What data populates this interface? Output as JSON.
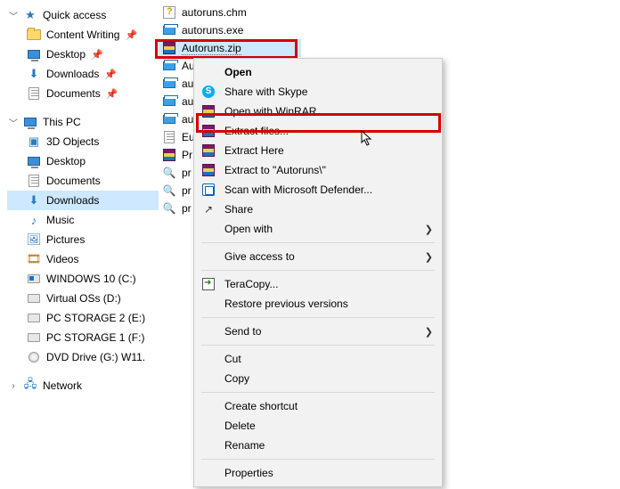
{
  "tree": {
    "quick_access": "Quick access",
    "qa_items": [
      {
        "label": "Content Writing"
      },
      {
        "label": "Desktop"
      },
      {
        "label": "Downloads"
      },
      {
        "label": "Documents"
      }
    ],
    "this_pc": "This PC",
    "pc_items": [
      {
        "label": "3D Objects"
      },
      {
        "label": "Desktop"
      },
      {
        "label": "Documents"
      },
      {
        "label": "Downloads",
        "selected": true
      },
      {
        "label": "Music"
      },
      {
        "label": "Pictures"
      },
      {
        "label": "Videos"
      },
      {
        "label": "WINDOWS 10 (C:)"
      },
      {
        "label": "Virtual OSs (D:)"
      },
      {
        "label": "PC STORAGE 2 (E:)"
      },
      {
        "label": "PC STORAGE 1 (F:)"
      },
      {
        "label": "DVD Drive (G:) W11."
      }
    ],
    "network": "Network"
  },
  "files": [
    {
      "icon": "chm",
      "label": "autoruns.chm"
    },
    {
      "icon": "exe",
      "label": "autoruns.exe"
    },
    {
      "icon": "rar",
      "label": "Autoruns.zip",
      "selected": true
    },
    {
      "icon": "exe",
      "label": "Au"
    },
    {
      "icon": "exe",
      "label": "au"
    },
    {
      "icon": "exe",
      "label": "au"
    },
    {
      "icon": "exe",
      "label": "au"
    },
    {
      "icon": "txt",
      "label": "Eu"
    },
    {
      "icon": "rar",
      "label": "Pr"
    },
    {
      "icon": "mag",
      "label": "pr"
    },
    {
      "icon": "mag",
      "label": "pr"
    },
    {
      "icon": "mag",
      "label": "pr"
    }
  ],
  "menu": [
    {
      "type": "item",
      "label": "Open",
      "bold": true
    },
    {
      "type": "item",
      "icon": "skype",
      "label": "Share with Skype"
    },
    {
      "type": "item",
      "icon": "rar",
      "label": "Open with WinRAR"
    },
    {
      "type": "item",
      "icon": "rar",
      "label": "Extract files...",
      "highlight": true
    },
    {
      "type": "item",
      "icon": "rar",
      "label": "Extract Here"
    },
    {
      "type": "item",
      "icon": "rar",
      "label": "Extract to \"Autoruns\\\""
    },
    {
      "type": "item",
      "icon": "def",
      "label": "Scan with Microsoft Defender..."
    },
    {
      "type": "item",
      "icon": "share",
      "label": "Share"
    },
    {
      "type": "item",
      "label": "Open with",
      "submenu": true
    },
    {
      "type": "sep"
    },
    {
      "type": "item",
      "label": "Give access to",
      "submenu": true
    },
    {
      "type": "sep"
    },
    {
      "type": "item",
      "icon": "tera",
      "label": "TeraCopy..."
    },
    {
      "type": "item",
      "label": "Restore previous versions"
    },
    {
      "type": "sep"
    },
    {
      "type": "item",
      "label": "Send to",
      "submenu": true
    },
    {
      "type": "sep"
    },
    {
      "type": "item",
      "label": "Cut"
    },
    {
      "type": "item",
      "label": "Copy"
    },
    {
      "type": "sep"
    },
    {
      "type": "item",
      "label": "Create shortcut"
    },
    {
      "type": "item",
      "label": "Delete"
    },
    {
      "type": "item",
      "label": "Rename"
    },
    {
      "type": "sep"
    },
    {
      "type": "item",
      "label": "Properties"
    }
  ]
}
